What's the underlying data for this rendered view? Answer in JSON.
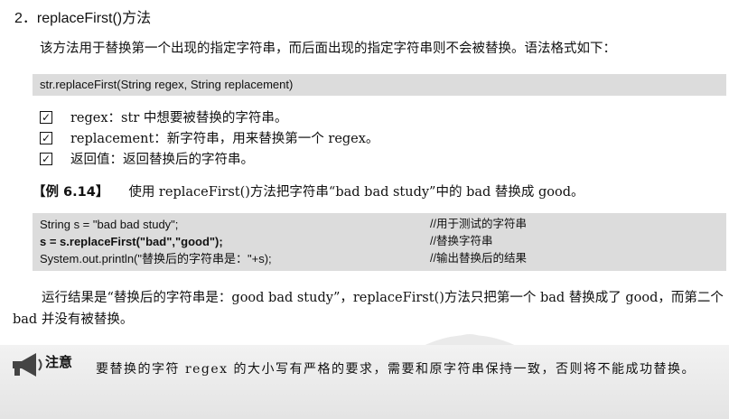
{
  "section": {
    "heading": "2．replaceFirst()方法",
    "intro": "该方法用于替换第一个出现的指定字符串，而后面出现的指定字符串则不会被替换。语法格式如下："
  },
  "syntax": "str.replaceFirst(String regex, String replacement)",
  "params": [
    {
      "text": "regex：str 中想要被替换的字符串。"
    },
    {
      "text": "replacement：新字符串，用来替换第一个 regex。"
    },
    {
      "text": "返回值：返回替换后的字符串。"
    }
  ],
  "example": {
    "tag": "【例 6.14】",
    "text": "使用 replaceFirst()方法把字符串“bad bad study”中的 bad 替换成 good。"
  },
  "code": [
    {
      "code": "String s = \"bad bad study\";",
      "comment": "//用于测试的字符串",
      "bold": false
    },
    {
      "code": "s = s.replaceFirst(\"bad\",\"good\");",
      "comment": "//替换字符串",
      "bold": true
    },
    {
      "code": "System.out.println(\"替换后的字符串是：\"+s);",
      "comment": "//输出替换后的结果",
      "bold": false
    }
  ],
  "result": "运行结果是“替换后的字符串是：good bad study”，replaceFirst()方法只把第一个 bad 替换成了 good，而第二个 bad 并没有被替换。",
  "note": {
    "title": "注意",
    "text": "要替换的字符 regex 的大小写有严格的要求，需要和原字符串保持一致，否则将不能成功替换。"
  }
}
